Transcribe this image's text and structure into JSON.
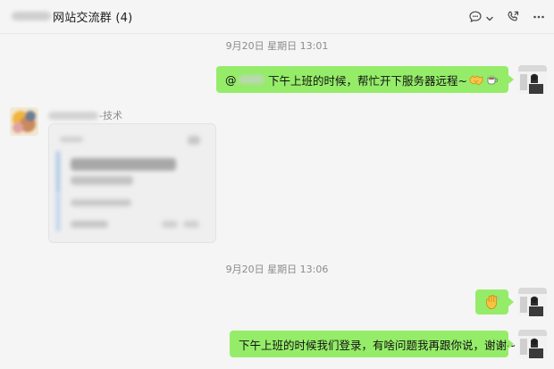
{
  "header": {
    "title": "网站交流群 (4)",
    "icons": [
      "chat-bubble-icon",
      "chevron-down-icon",
      "phone-call-icon",
      "more-icon"
    ]
  },
  "messages": [
    {
      "type": "time",
      "text": "9月20日 星期日 13:01"
    },
    {
      "type": "outgoing_text",
      "prefix": "@",
      "text": "下午上班的时候，帮忙开下服务器远程~",
      "emojis": [
        "handshake-icon",
        "coffee-icon"
      ]
    },
    {
      "type": "incoming_card",
      "sender_suffix": "-技术"
    },
    {
      "type": "time",
      "text": "9月20日 星期日 13:06"
    },
    {
      "type": "outgoing_emoji",
      "emoji": "waving-hand-icon"
    },
    {
      "type": "outgoing_text",
      "text": "下午上班的时候我们登录，有啥问题我再跟你说，谢谢~"
    }
  ],
  "colors": {
    "bubble_green": "#95ec69",
    "background": "#f5f5f5"
  }
}
